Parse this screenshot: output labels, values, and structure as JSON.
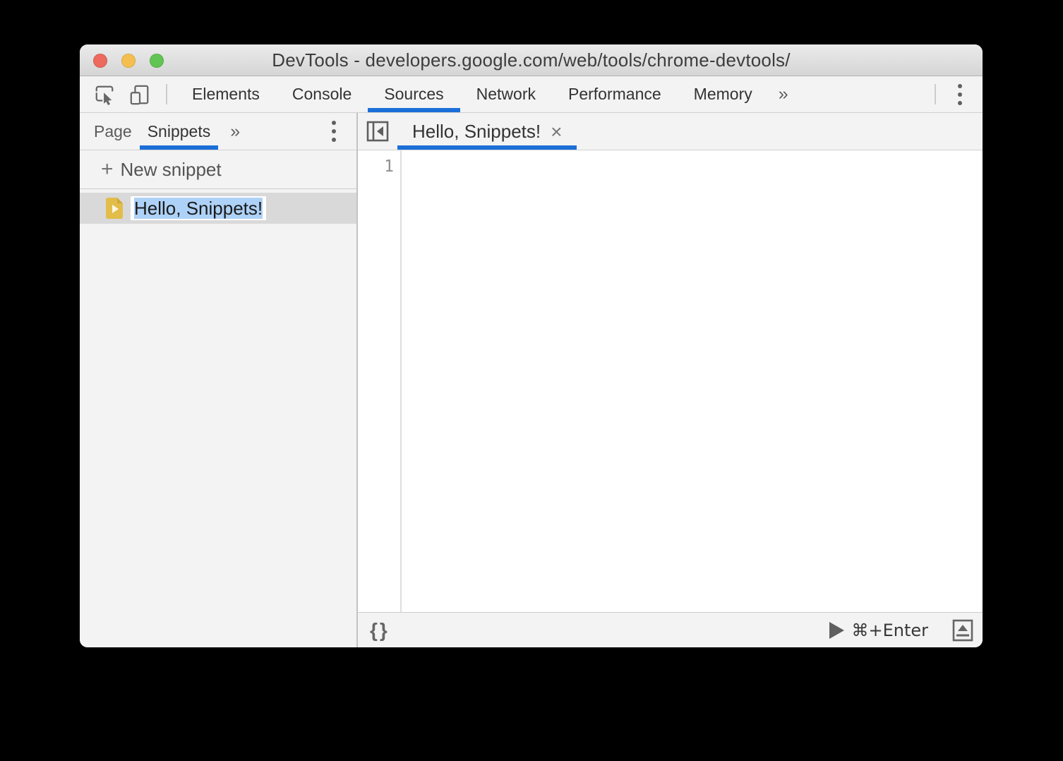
{
  "colors": {
    "accent": "#1b6fd8",
    "selection": "#aed2f7",
    "snippet_icon": "#e2bd4a",
    "traffic_red": "#ed6a5e",
    "traffic_yellow": "#f5bf4f",
    "traffic_green": "#61c554"
  },
  "window": {
    "title": "DevTools - developers.google.com/web/tools/chrome-devtools/"
  },
  "toolbar": {
    "tabs": [
      {
        "label": "Elements",
        "selected": false
      },
      {
        "label": "Console",
        "selected": false
      },
      {
        "label": "Sources",
        "selected": true
      },
      {
        "label": "Network",
        "selected": false
      },
      {
        "label": "Performance",
        "selected": false
      },
      {
        "label": "Memory",
        "selected": false
      }
    ],
    "more_tabs_glyph": "»",
    "icons": {
      "inspect": "inspect-cursor-icon",
      "device": "device-toolbar-icon",
      "menu": "kebab-menu-icon"
    }
  },
  "sidebar": {
    "tabs": [
      {
        "label": "Page",
        "selected": false
      },
      {
        "label": "Snippets",
        "selected": true
      }
    ],
    "more_tabs_glyph": "»",
    "new_snippet": {
      "plus_glyph": "+",
      "label": "New snippet"
    },
    "items": [
      {
        "name": "Hello, Snippets!",
        "selected": true,
        "editing": true,
        "icon": "snippet-file-icon"
      }
    ]
  },
  "editor": {
    "tab": {
      "label": "Hello, Snippets!",
      "close_glyph": "×"
    },
    "line_numbers": [
      "1"
    ],
    "content": ""
  },
  "statusbar": {
    "format_glyph": "{}",
    "run_shortcut": "⌘+Enter"
  }
}
